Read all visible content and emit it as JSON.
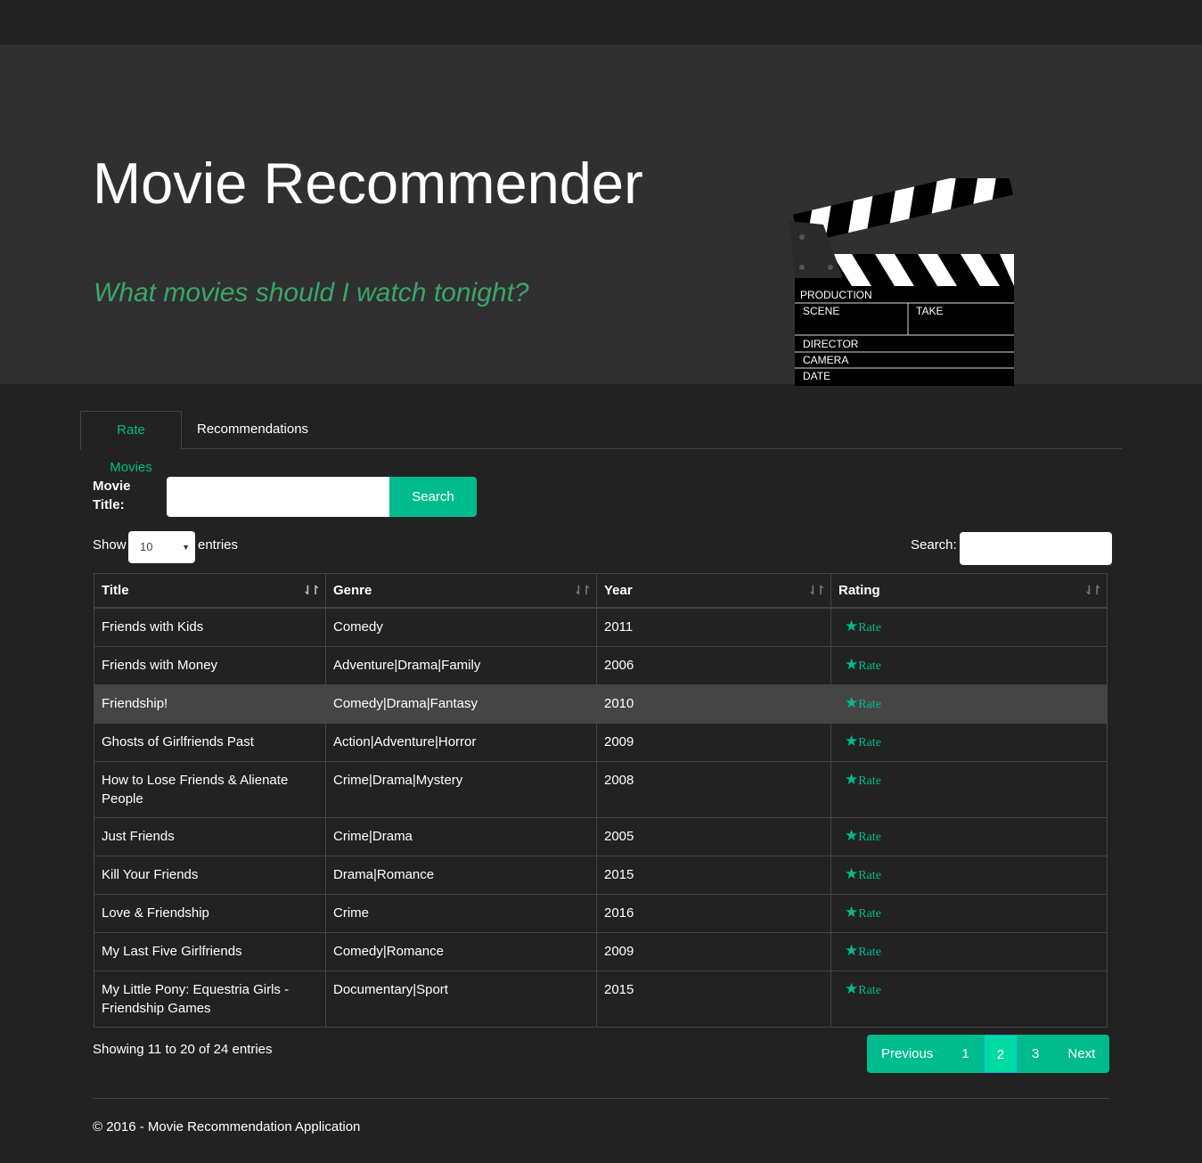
{
  "header": {
    "title": "Movie Recommender",
    "subtitle": "What movies should I watch tonight?",
    "clapper": {
      "production": "PRODUCTION",
      "scene": "SCENE",
      "take": "TAKE",
      "director": "DIRECTOR",
      "camera": "CAMERA",
      "date": "DATE"
    }
  },
  "tabs": [
    {
      "label": "Rate Movies",
      "active": true
    },
    {
      "label": "Recommendations",
      "active": false
    }
  ],
  "search_form": {
    "label": "Movie Title:",
    "value": "",
    "button": "Search"
  },
  "datatable": {
    "show_label": "Show",
    "length_value": "10",
    "entries_label": "entries",
    "search_label": "Search:",
    "search_value": "",
    "columns": [
      "Title",
      "Genre",
      "Year",
      "Rating"
    ],
    "rows": [
      {
        "title": "Friends with Kids",
        "genre": "Comedy",
        "year": "2011",
        "rate": "Rate"
      },
      {
        "title": "Friends with Money",
        "genre": "Adventure|Drama|Family",
        "year": "2006",
        "rate": "Rate"
      },
      {
        "title": "Friendship!",
        "genre": "Comedy|Drama|Fantasy",
        "year": "2010",
        "rate": "Rate"
      },
      {
        "title": "Ghosts of Girlfriends Past",
        "genre": "Action|Adventure|Horror",
        "year": "2009",
        "rate": "Rate"
      },
      {
        "title": "How to Lose Friends & Alienate People",
        "genre": "Crime|Drama|Mystery",
        "year": "2008",
        "rate": "Rate"
      },
      {
        "title": "Just Friends",
        "genre": "Crime|Drama",
        "year": "2005",
        "rate": "Rate"
      },
      {
        "title": "Kill Your Friends",
        "genre": "Drama|Romance",
        "year": "2015",
        "rate": "Rate"
      },
      {
        "title": "Love & Friendship",
        "genre": "Crime",
        "year": "2016",
        "rate": "Rate"
      },
      {
        "title": "My Last Five Girlfriends",
        "genre": "Comedy|Romance",
        "year": "2009",
        "rate": "Rate"
      },
      {
        "title": "My Little Pony: Equestria Girls - Friendship Games",
        "genre": "Documentary|Sport",
        "year": "2015",
        "rate": "Rate"
      }
    ],
    "info": "Showing 11 to 20 of 24 entries",
    "pagination": {
      "previous": "Previous",
      "pages": [
        "1",
        "2",
        "3"
      ],
      "current": "2",
      "next": "Next"
    }
  },
  "footer": {
    "text": "© 2016 - Movie Recommendation Application"
  },
  "colors": {
    "accent": "#00bc8c",
    "subtitle": "#3aa769",
    "background": "#222222",
    "jumbotron": "#303030"
  }
}
